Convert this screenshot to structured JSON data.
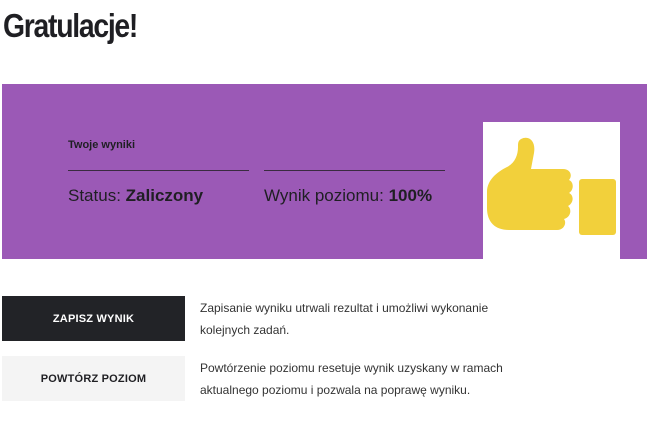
{
  "page": {
    "title": "Gratulacje!"
  },
  "results": {
    "heading": "Twoje wyniki",
    "status_label": "Status:",
    "status_value": "Zaliczony",
    "score_label": "Wynik poziomu:",
    "score_value": "100%"
  },
  "colors": {
    "banner": "#9b59b6",
    "thumb": "#f2d03b",
    "save_button": "#222327",
    "retry_button": "#f4f4f4"
  },
  "actions": [
    {
      "label": "ZAPISZ WYNIK",
      "description": "Zapisanie wyniku utrwali rezultat i umożliwi wykonanie kolejnych zadań."
    },
    {
      "label": "POWTÓRZ POZIOM",
      "description": "Powtórzenie poziomu resetuje wynik uzyskany w ramach aktualnego poziomu i pozwala na poprawę wyniku."
    }
  ],
  "icons": {
    "result_icon": "thumbs-up-icon"
  }
}
